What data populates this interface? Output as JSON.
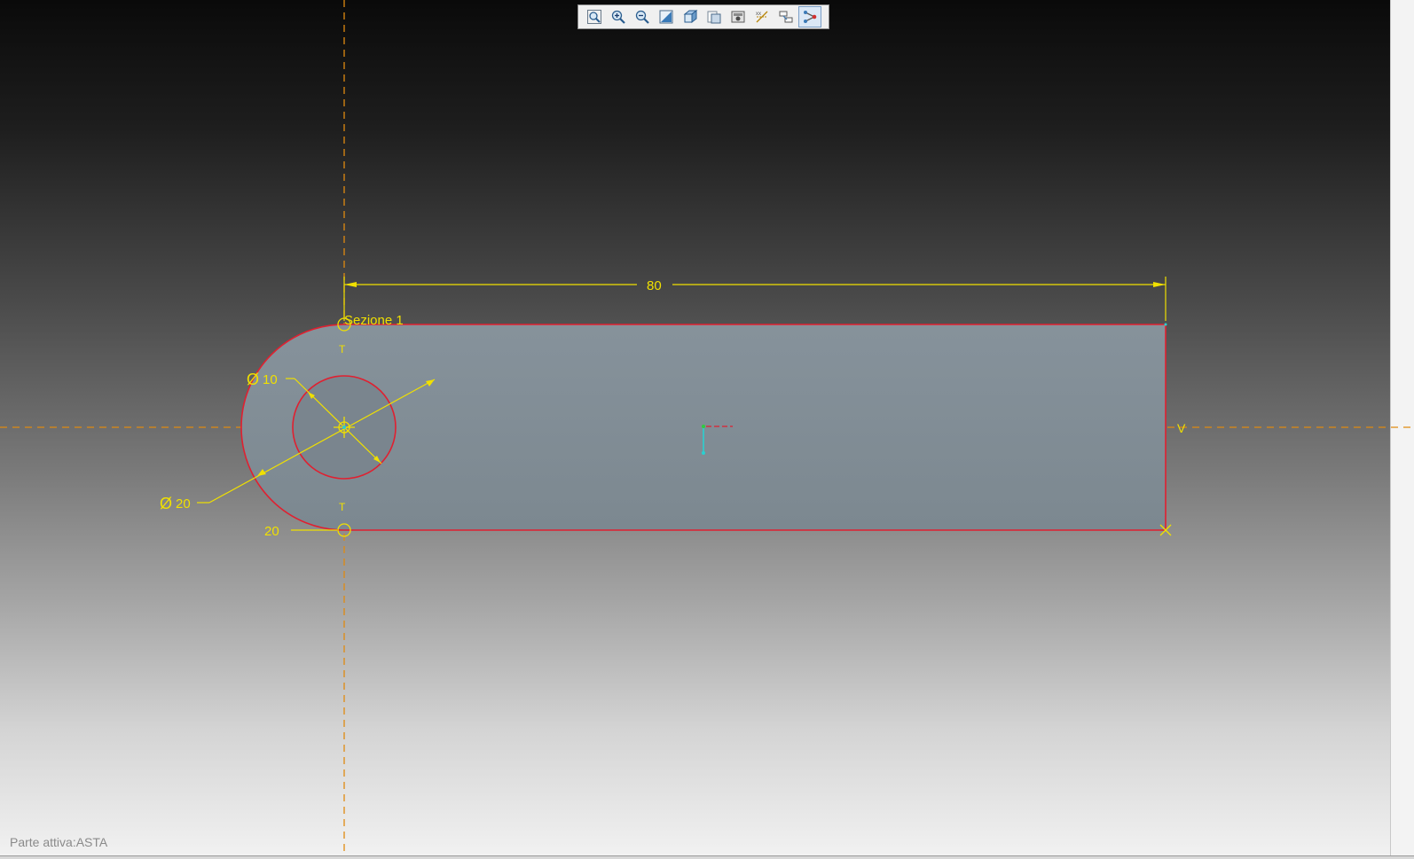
{
  "toolbar": {
    "buttons": [
      {
        "icon": "zoom-fit-icon",
        "active": false
      },
      {
        "icon": "zoom-in-icon",
        "active": false
      },
      {
        "icon": "zoom-out-icon",
        "active": false
      },
      {
        "icon": "view-normal-icon",
        "active": false
      },
      {
        "icon": "cube-view-icon",
        "active": false
      },
      {
        "icon": "display-style-icon",
        "active": false
      },
      {
        "icon": "saved-views-icon",
        "active": false
      },
      {
        "icon": "datum-display-icon",
        "active": false
      },
      {
        "icon": "annotation-display-icon",
        "active": false
      },
      {
        "icon": "sketch-constraints-icon",
        "active": true
      }
    ]
  },
  "sketch": {
    "section_label": "Sezione 1",
    "dim_length": "80",
    "dim_small_dia_symbol": "Ø",
    "dim_small_dia_value": "10",
    "dim_large_dia_symbol": "Ø",
    "dim_large_dia_value": "20",
    "dim_offset": "20",
    "constraint_vertical": "V",
    "constraint_tangent_top": "T",
    "constraint_tangent_bottom": "T"
  },
  "colors": {
    "profile": "#e02030",
    "dimension": "#f0e000",
    "centerline": "#e08a10",
    "fill": "#8a96a0"
  },
  "status": {
    "active_part": "Parte attiva:ASTA"
  }
}
